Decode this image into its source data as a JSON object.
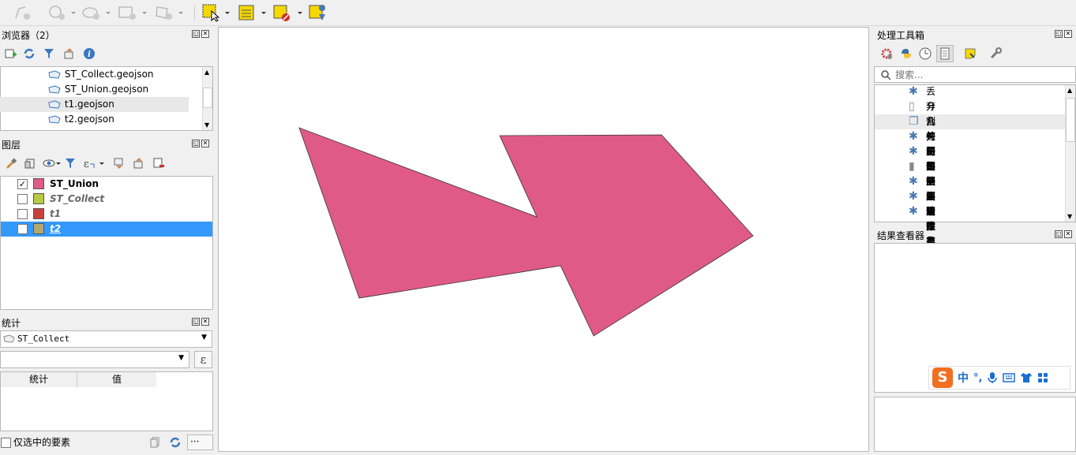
{
  "browser": {
    "title": "浏览器（2）",
    "items": [
      "ST_Collect.geojson",
      "ST_Union.geojson",
      "t1.geojson",
      "t2.geojson"
    ]
  },
  "layers": {
    "title": "图层",
    "items": [
      {
        "name": "ST_Union",
        "checked": true,
        "color": "#e05a87"
      },
      {
        "name": "ST_Collect",
        "checked": false,
        "color": "#b9c944"
      },
      {
        "name": "t1",
        "checked": false,
        "color": "#c8403c"
      },
      {
        "name": "t2",
        "checked": false,
        "color": "#b4a86e"
      }
    ]
  },
  "stats": {
    "title": "统计",
    "layer_select": "ST_Collect",
    "col_stat": "统计",
    "col_value": "值",
    "selected_only_label": "仅选中的要素",
    "epsilon": "ε",
    "more": "···"
  },
  "toolbox": {
    "title": "处理工具箱",
    "search_placeholder": "搜索...",
    "items": [
      "丢弃几何图形",
      "分割矢量图层",
      "合并矢量图层",
      "检测数据集更改",
      "将矢量要素保存到文件",
      "将图层转换为空间书签",
      "快速清空表格",
      "删除重复几何图形",
      "删除重复属性"
    ]
  },
  "results": {
    "title": "结果查看器"
  },
  "ime": {
    "logo": "S",
    "mode": "中",
    "punct": "°,"
  },
  "colors": {
    "union_fill": "#e05a87",
    "selected_row": "#3399ff"
  }
}
